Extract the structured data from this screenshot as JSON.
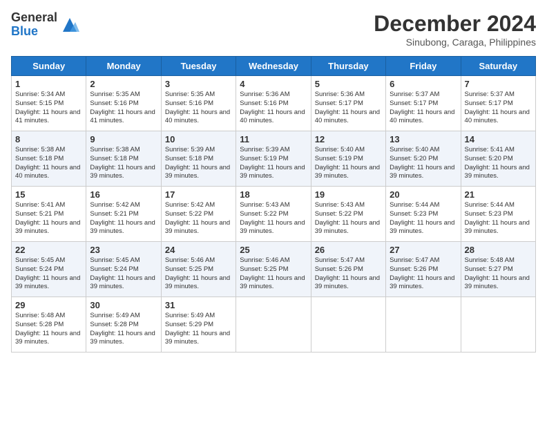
{
  "header": {
    "logo_general": "General",
    "logo_blue": "Blue",
    "month_title": "December 2024",
    "subtitle": "Sinubong, Caraga, Philippines"
  },
  "weekdays": [
    "Sunday",
    "Monday",
    "Tuesday",
    "Wednesday",
    "Thursday",
    "Friday",
    "Saturday"
  ],
  "weeks": [
    [
      {
        "day": "1",
        "sunrise": "Sunrise: 5:34 AM",
        "sunset": "Sunset: 5:15 PM",
        "daylight": "Daylight: 11 hours and 41 minutes."
      },
      {
        "day": "2",
        "sunrise": "Sunrise: 5:35 AM",
        "sunset": "Sunset: 5:16 PM",
        "daylight": "Daylight: 11 hours and 41 minutes."
      },
      {
        "day": "3",
        "sunrise": "Sunrise: 5:35 AM",
        "sunset": "Sunset: 5:16 PM",
        "daylight": "Daylight: 11 hours and 40 minutes."
      },
      {
        "day": "4",
        "sunrise": "Sunrise: 5:36 AM",
        "sunset": "Sunset: 5:16 PM",
        "daylight": "Daylight: 11 hours and 40 minutes."
      },
      {
        "day": "5",
        "sunrise": "Sunrise: 5:36 AM",
        "sunset": "Sunset: 5:17 PM",
        "daylight": "Daylight: 11 hours and 40 minutes."
      },
      {
        "day": "6",
        "sunrise": "Sunrise: 5:37 AM",
        "sunset": "Sunset: 5:17 PM",
        "daylight": "Daylight: 11 hours and 40 minutes."
      },
      {
        "day": "7",
        "sunrise": "Sunrise: 5:37 AM",
        "sunset": "Sunset: 5:17 PM",
        "daylight": "Daylight: 11 hours and 40 minutes."
      }
    ],
    [
      {
        "day": "8",
        "sunrise": "Sunrise: 5:38 AM",
        "sunset": "Sunset: 5:18 PM",
        "daylight": "Daylight: 11 hours and 40 minutes."
      },
      {
        "day": "9",
        "sunrise": "Sunrise: 5:38 AM",
        "sunset": "Sunset: 5:18 PM",
        "daylight": "Daylight: 11 hours and 39 minutes."
      },
      {
        "day": "10",
        "sunrise": "Sunrise: 5:39 AM",
        "sunset": "Sunset: 5:18 PM",
        "daylight": "Daylight: 11 hours and 39 minutes."
      },
      {
        "day": "11",
        "sunrise": "Sunrise: 5:39 AM",
        "sunset": "Sunset: 5:19 PM",
        "daylight": "Daylight: 11 hours and 39 minutes."
      },
      {
        "day": "12",
        "sunrise": "Sunrise: 5:40 AM",
        "sunset": "Sunset: 5:19 PM",
        "daylight": "Daylight: 11 hours and 39 minutes."
      },
      {
        "day": "13",
        "sunrise": "Sunrise: 5:40 AM",
        "sunset": "Sunset: 5:20 PM",
        "daylight": "Daylight: 11 hours and 39 minutes."
      },
      {
        "day": "14",
        "sunrise": "Sunrise: 5:41 AM",
        "sunset": "Sunset: 5:20 PM",
        "daylight": "Daylight: 11 hours and 39 minutes."
      }
    ],
    [
      {
        "day": "15",
        "sunrise": "Sunrise: 5:41 AM",
        "sunset": "Sunset: 5:21 PM",
        "daylight": "Daylight: 11 hours and 39 minutes."
      },
      {
        "day": "16",
        "sunrise": "Sunrise: 5:42 AM",
        "sunset": "Sunset: 5:21 PM",
        "daylight": "Daylight: 11 hours and 39 minutes."
      },
      {
        "day": "17",
        "sunrise": "Sunrise: 5:42 AM",
        "sunset": "Sunset: 5:22 PM",
        "daylight": "Daylight: 11 hours and 39 minutes."
      },
      {
        "day": "18",
        "sunrise": "Sunrise: 5:43 AM",
        "sunset": "Sunset: 5:22 PM",
        "daylight": "Daylight: 11 hours and 39 minutes."
      },
      {
        "day": "19",
        "sunrise": "Sunrise: 5:43 AM",
        "sunset": "Sunset: 5:22 PM",
        "daylight": "Daylight: 11 hours and 39 minutes."
      },
      {
        "day": "20",
        "sunrise": "Sunrise: 5:44 AM",
        "sunset": "Sunset: 5:23 PM",
        "daylight": "Daylight: 11 hours and 39 minutes."
      },
      {
        "day": "21",
        "sunrise": "Sunrise: 5:44 AM",
        "sunset": "Sunset: 5:23 PM",
        "daylight": "Daylight: 11 hours and 39 minutes."
      }
    ],
    [
      {
        "day": "22",
        "sunrise": "Sunrise: 5:45 AM",
        "sunset": "Sunset: 5:24 PM",
        "daylight": "Daylight: 11 hours and 39 minutes."
      },
      {
        "day": "23",
        "sunrise": "Sunrise: 5:45 AM",
        "sunset": "Sunset: 5:24 PM",
        "daylight": "Daylight: 11 hours and 39 minutes."
      },
      {
        "day": "24",
        "sunrise": "Sunrise: 5:46 AM",
        "sunset": "Sunset: 5:25 PM",
        "daylight": "Daylight: 11 hours and 39 minutes."
      },
      {
        "day": "25",
        "sunrise": "Sunrise: 5:46 AM",
        "sunset": "Sunset: 5:25 PM",
        "daylight": "Daylight: 11 hours and 39 minutes."
      },
      {
        "day": "26",
        "sunrise": "Sunrise: 5:47 AM",
        "sunset": "Sunset: 5:26 PM",
        "daylight": "Daylight: 11 hours and 39 minutes."
      },
      {
        "day": "27",
        "sunrise": "Sunrise: 5:47 AM",
        "sunset": "Sunset: 5:26 PM",
        "daylight": "Daylight: 11 hours and 39 minutes."
      },
      {
        "day": "28",
        "sunrise": "Sunrise: 5:48 AM",
        "sunset": "Sunset: 5:27 PM",
        "daylight": "Daylight: 11 hours and 39 minutes."
      }
    ],
    [
      {
        "day": "29",
        "sunrise": "Sunrise: 5:48 AM",
        "sunset": "Sunset: 5:28 PM",
        "daylight": "Daylight: 11 hours and 39 minutes."
      },
      {
        "day": "30",
        "sunrise": "Sunrise: 5:49 AM",
        "sunset": "Sunset: 5:28 PM",
        "daylight": "Daylight: 11 hours and 39 minutes."
      },
      {
        "day": "31",
        "sunrise": "Sunrise: 5:49 AM",
        "sunset": "Sunset: 5:29 PM",
        "daylight": "Daylight: 11 hours and 39 minutes."
      },
      null,
      null,
      null,
      null
    ]
  ]
}
